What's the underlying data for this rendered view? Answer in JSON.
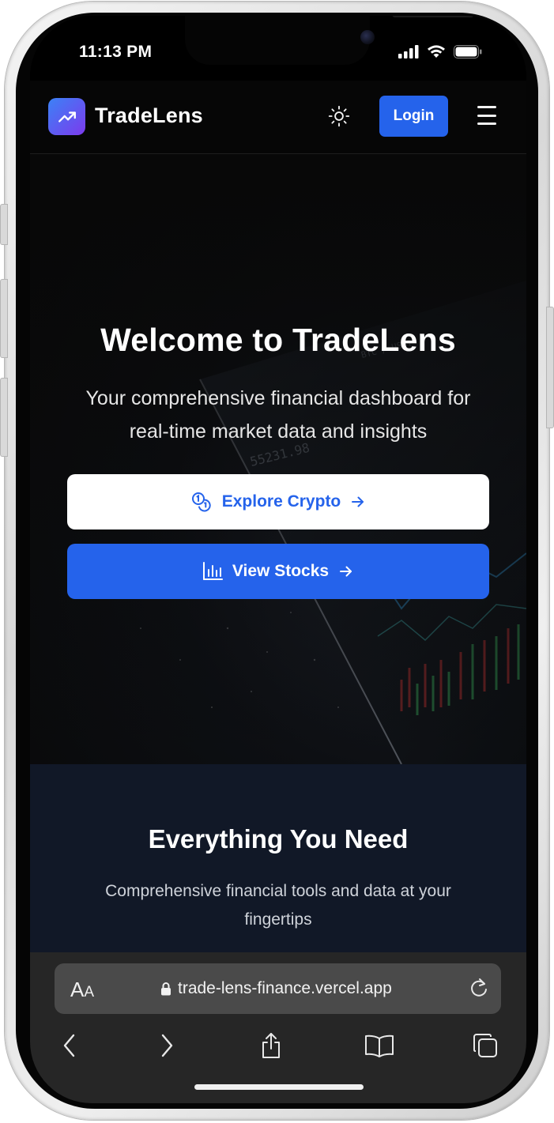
{
  "status_bar": {
    "time": "11:13 PM"
  },
  "navbar": {
    "brand": "TradeLens",
    "login_label": "Login"
  },
  "hero": {
    "title": "Welcome to TradeLens",
    "subtitle": "Your comprehensive financial dashboard for real-time market data and insights",
    "crypto_button": "Explore Crypto",
    "stocks_button": "View Stocks"
  },
  "features": {
    "title": "Everything You Need",
    "subtitle": "Comprehensive financial tools and data at your fingertips"
  },
  "browser": {
    "reader_label_big": "A",
    "reader_label_small": "A",
    "url": "trade-lens-finance.vercel.app"
  },
  "colors": {
    "accent": "#2563eb",
    "logo_gradient_start": "#3b82f6",
    "logo_gradient_end": "#7c3aed",
    "features_bg": "#111827"
  },
  "icons": [
    "trending-up-icon",
    "sun-icon",
    "menu-icon",
    "coins-icon",
    "arrow-right-icon",
    "bar-chart-icon",
    "lock-icon",
    "reload-icon",
    "back-icon",
    "forward-icon",
    "share-icon",
    "bookmarks-icon",
    "tabs-icon",
    "signal-icon",
    "wifi-icon",
    "battery-icon"
  ]
}
